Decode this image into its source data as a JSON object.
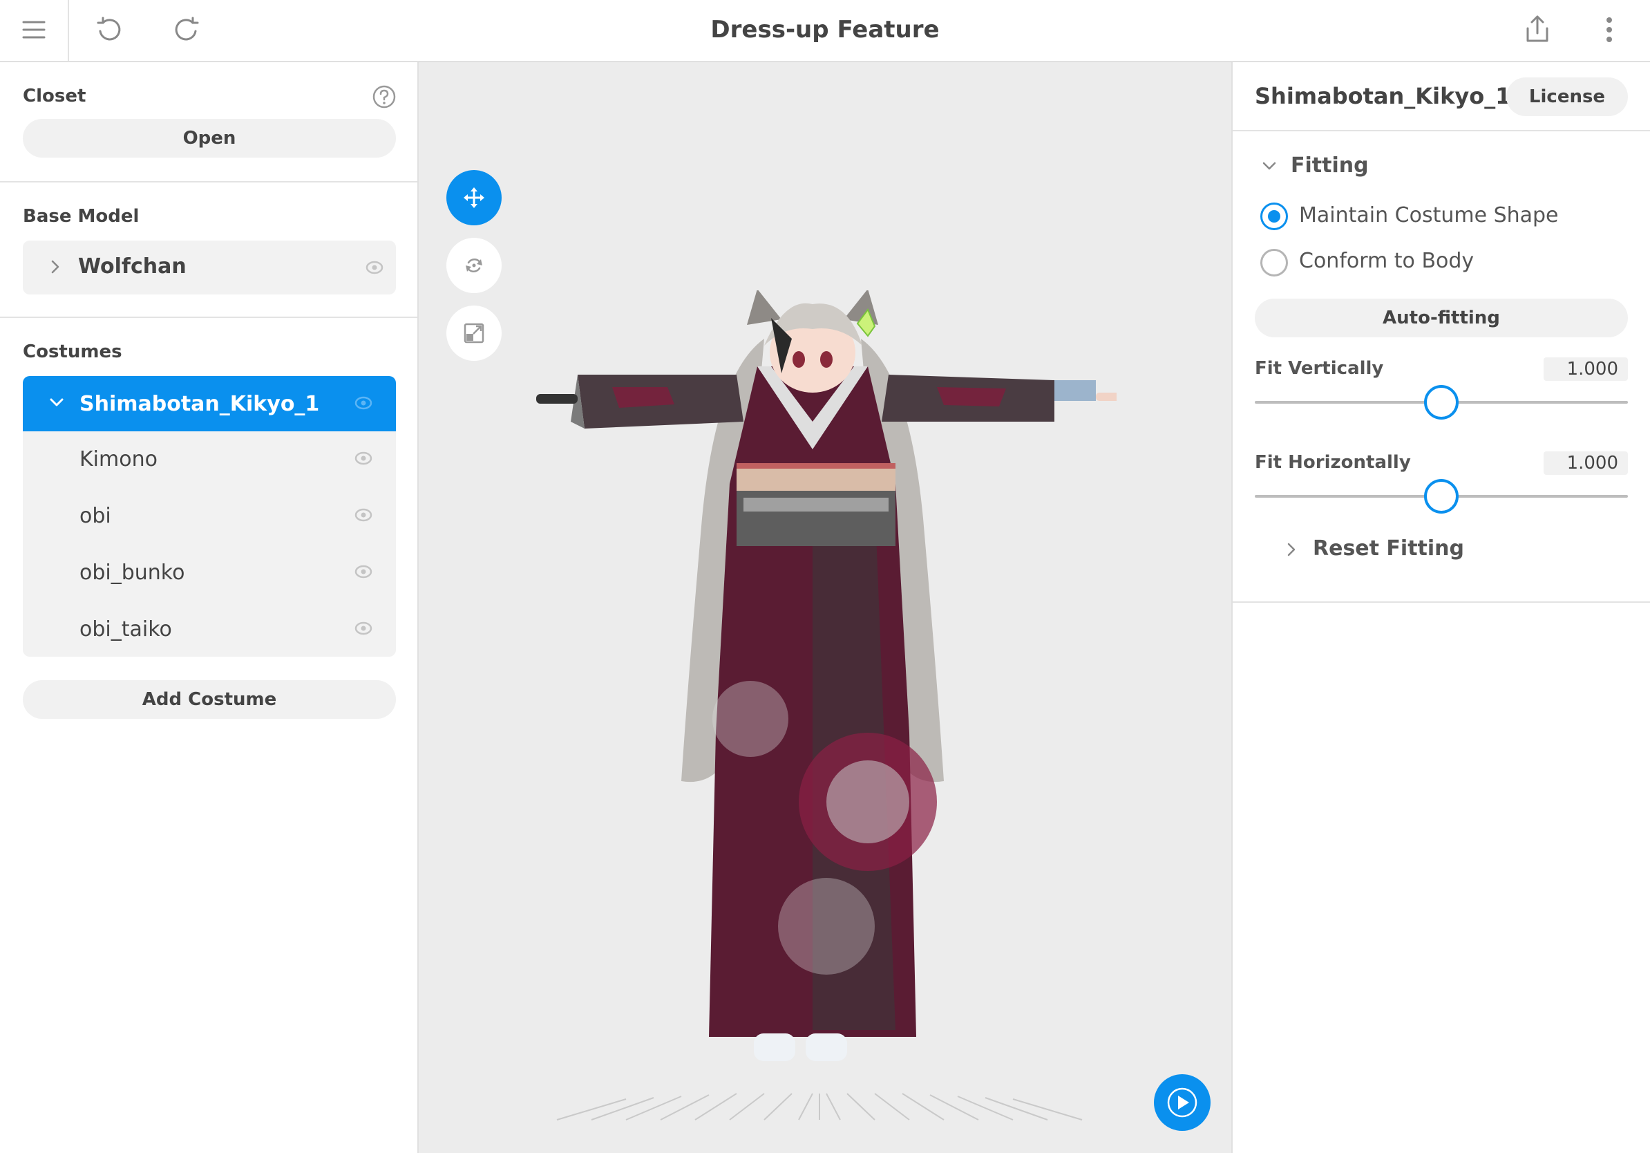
{
  "header": {
    "title": "Dress-up Feature",
    "icons": {
      "menu": "menu-icon",
      "undo": "undo-icon",
      "redo": "redo-icon",
      "share": "share-icon",
      "more": "more-vertical-icon"
    }
  },
  "closet": {
    "label": "Closet",
    "open_label": "Open",
    "help_icon": "help-icon"
  },
  "base_model": {
    "label": "Base Model",
    "name": "Wolfchan"
  },
  "costumes": {
    "label": "Costumes",
    "items": [
      {
        "label": "Shimabotan_Kikyo_1",
        "selected": true
      },
      {
        "label": "Kimono"
      },
      {
        "label": "obi"
      },
      {
        "label": "obi_bunko"
      },
      {
        "label": "obi_taiko"
      }
    ],
    "add_label": "Add Costume"
  },
  "inspector": {
    "title": "Shimabotan_Kikyo_1",
    "license_label": "License",
    "fitting": {
      "label": "Fitting",
      "options": [
        {
          "label": "Maintain Costume Shape",
          "selected": true
        },
        {
          "label": "Conform to Body",
          "selected": false
        }
      ],
      "auto_fitting_label": "Auto-fitting",
      "fit_vertically": {
        "label": "Fit Vertically",
        "value": "1.000",
        "position": 0.5
      },
      "fit_horizontally": {
        "label": "Fit Horizontally",
        "value": "1.000",
        "position": 0.5
      },
      "reset_label": "Reset Fitting"
    }
  },
  "colors": {
    "accent": "#0a90ee",
    "viewport_bg": "#ececec",
    "panel_bg": "#ffffff"
  }
}
